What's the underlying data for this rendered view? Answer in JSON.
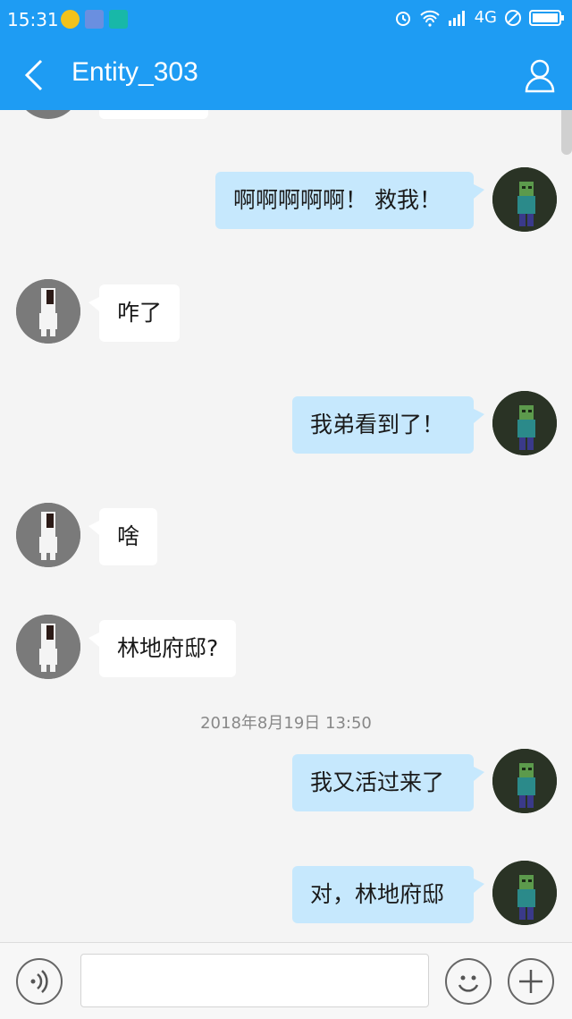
{
  "status_bar": {
    "time": "15:31",
    "network": "4G"
  },
  "header": {
    "title": "Entity_303"
  },
  "messages": [
    {
      "side": "right",
      "text": "啊啊啊啊啊！ 救我！"
    },
    {
      "side": "left",
      "text": "咋了"
    },
    {
      "side": "right",
      "text": "我弟看到了！"
    },
    {
      "side": "left",
      "text": "啥"
    },
    {
      "side": "left",
      "text": "林地府邸?"
    },
    {
      "side": "right",
      "text": "我又活过来了"
    },
    {
      "side": "right",
      "text": "对，林地府邸"
    }
  ],
  "timestamp": "2018年8月19日 13:50",
  "input": {
    "placeholder": ""
  },
  "colors": {
    "header": "#1e9cf3",
    "bubble_out": "#c6e8fd",
    "bubble_in": "#ffffff"
  }
}
